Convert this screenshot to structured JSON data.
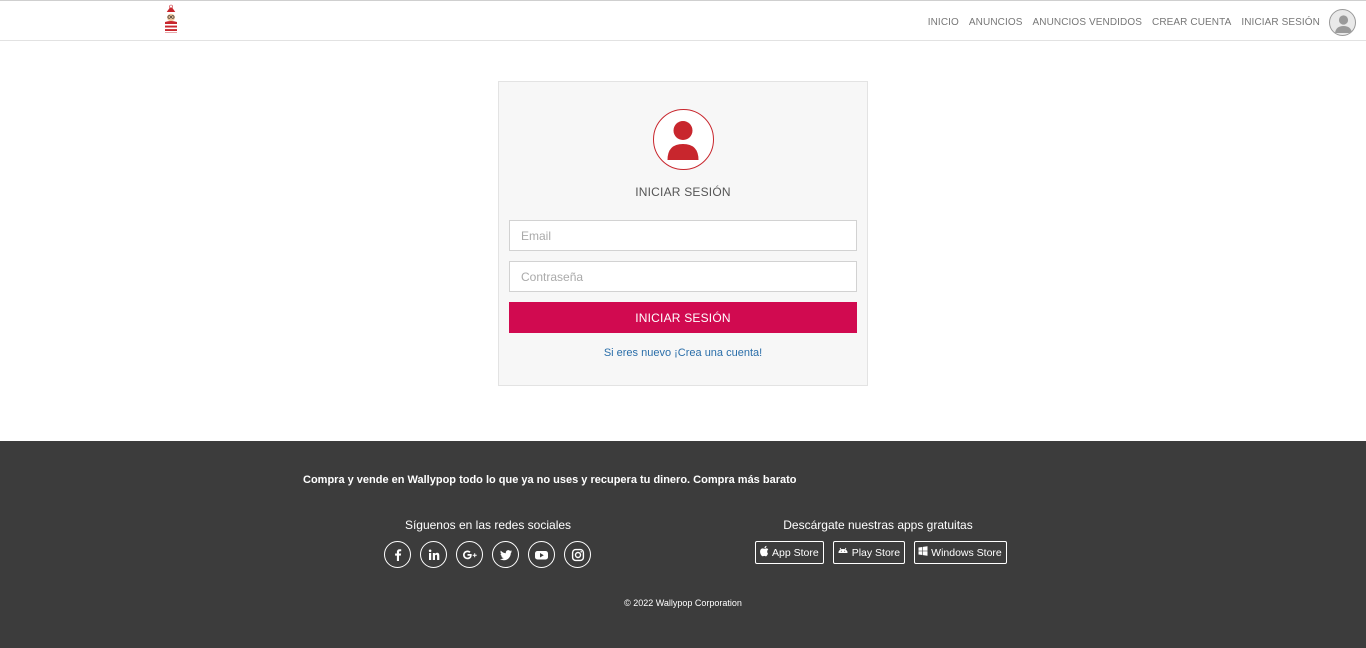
{
  "header": {
    "logo_alt": "Wallypop",
    "nav": [
      {
        "label": "INICIO"
      },
      {
        "label": "ANUNCIOS"
      },
      {
        "label": "ANUNCIOS VENDIDOS"
      },
      {
        "label": "CREAR CUENTA"
      },
      {
        "label": "INICIAR SESIÓN"
      }
    ]
  },
  "login": {
    "title": "INICIAR SESIÓN",
    "email_placeholder": "Email",
    "email_value": "",
    "password_placeholder": "Contraseña",
    "password_value": "",
    "submit_label": "INICIAR SESIÓN",
    "register_link": "Si eres nuevo ¡Crea una cuenta!"
  },
  "footer": {
    "tagline": "Compra y vende en Wallypop todo lo que ya no uses y recupera tu dinero. Compra más barato",
    "social_title": "Síguenos en las redes sociales",
    "social_icons": [
      "facebook-icon",
      "linkedin-icon",
      "google-plus-icon",
      "twitter-icon",
      "youtube-icon",
      "instagram-icon"
    ],
    "apps_title": "Descárgate nuestras apps gratuitas",
    "apps": [
      {
        "label": "App Store",
        "icon": "apple-icon"
      },
      {
        "label": "Play Store",
        "icon": "android-icon"
      },
      {
        "label": "Windows Store",
        "icon": "windows-icon"
      }
    ],
    "copyright": "© 2022 Wallypop Corporation"
  },
  "colors": {
    "accent": "#d10a50",
    "icon_red": "#c8262d",
    "footer_bg": "#3c3c3c",
    "link": "#2a6ea9"
  }
}
